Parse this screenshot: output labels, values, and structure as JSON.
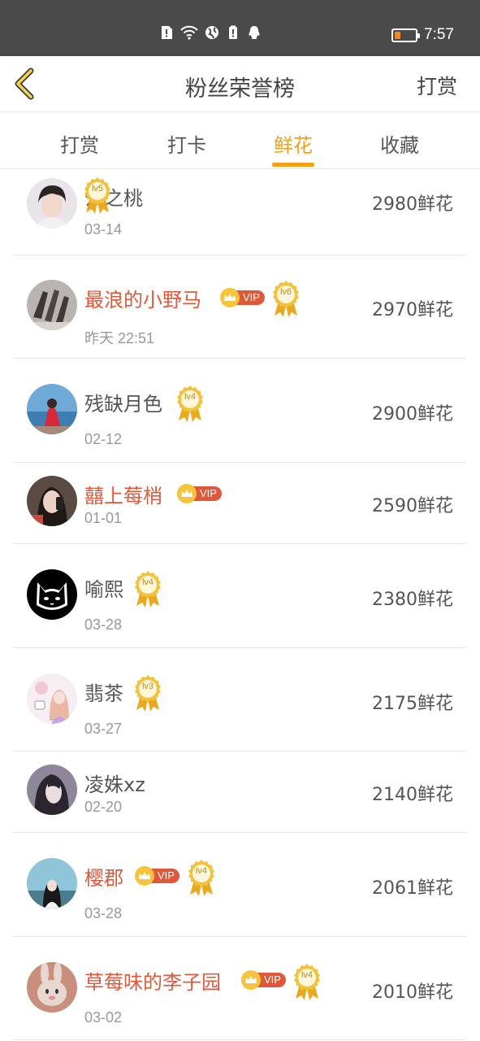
{
  "status_bar": {
    "time": "7:57",
    "battery_level": 0.3,
    "icons": [
      "alert-icon",
      "wifi-icon",
      "globe-icon",
      "battery-saver-icon",
      "qq-icon"
    ]
  },
  "header": {
    "title": "粉丝荣誉榜",
    "right_action": "打赏"
  },
  "tabs": [
    {
      "label": "打赏",
      "active": false
    },
    {
      "label": "打卡",
      "active": false
    },
    {
      "label": "鲜花",
      "active": true
    },
    {
      "label": "收藏",
      "active": false
    }
  ],
  "accent_color": "#f5a116",
  "vip_name_color": "#e0583a",
  "rows": [
    {
      "name": "云之桃",
      "date": "03-14",
      "amount": "2980鲜花",
      "vip": false,
      "level": "lv5"
    },
    {
      "name": "最浪的小野马",
      "date": "昨天 22:51",
      "amount": "2970鲜花",
      "vip": true,
      "level": "lv6"
    },
    {
      "name": "残缺月色",
      "date": "02-12",
      "amount": "2900鲜花",
      "vip": false,
      "level": "lv4"
    },
    {
      "name": "囍上莓梢",
      "date": "01-01",
      "amount": "2590鲜花",
      "vip": true,
      "level": ""
    },
    {
      "name": "喻熙",
      "date": "03-28",
      "amount": "2380鲜花",
      "vip": false,
      "level": "lv4"
    },
    {
      "name": "翡茶",
      "date": "03-27",
      "amount": "2175鲜花",
      "vip": false,
      "level": "lv3"
    },
    {
      "name": "凌姝xz",
      "date": "02-20",
      "amount": "2140鲜花",
      "vip": false,
      "level": ""
    },
    {
      "name": "樱郡",
      "date": "03-28",
      "amount": "2061鲜花",
      "vip": true,
      "level": "lv4"
    },
    {
      "name": "草莓味的李子园",
      "date": "03-02",
      "amount": "2010鲜花",
      "vip": true,
      "level": "lv4"
    }
  ],
  "vip_label": "VIP"
}
